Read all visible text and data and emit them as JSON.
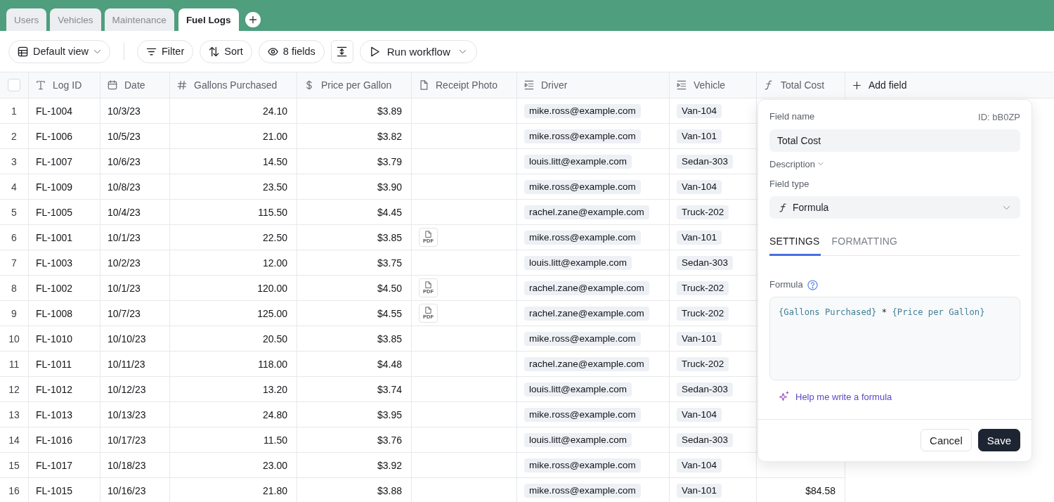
{
  "tabs": [
    {
      "label": "Users",
      "selected": false
    },
    {
      "label": "Vehicles",
      "selected": false
    },
    {
      "label": "Maintenance",
      "selected": false
    },
    {
      "label": "Fuel Logs",
      "selected": true
    }
  ],
  "toolbar": [
    {
      "kind": "view",
      "label": "Default view"
    },
    {
      "kind": "filter",
      "label": "Filter"
    },
    {
      "kind": "sort",
      "label": "Sort"
    },
    {
      "kind": "fields",
      "label": "8 fields"
    },
    {
      "kind": "row_height"
    },
    {
      "kind": "workflow",
      "label": "Run workflow"
    }
  ],
  "table": {
    "select_all": {
      "checked": false
    },
    "columns": [
      {
        "label": "Log ID",
        "kind": "text"
      },
      {
        "label": "Date",
        "kind": "date"
      },
      {
        "label": "Gallons Purchased",
        "kind": "number"
      },
      {
        "label": "Price per Gallon",
        "kind": "currency"
      },
      {
        "label": "Receipt Photo",
        "kind": "attachment"
      },
      {
        "label": "Driver",
        "kind": "link"
      },
      {
        "label": "Vehicle",
        "kind": "link"
      },
      {
        "label": "Total Cost",
        "kind": "formula"
      }
    ],
    "add_field": "Add field",
    "rows": [
      {
        "number": "1",
        "cells": [
          "FL-1004",
          "10/3/23",
          "24.10",
          "$3.89",
          null,
          "mike.ross@example.com",
          "Van-104",
          null
        ]
      },
      {
        "number": "2",
        "cells": [
          "FL-1006",
          "10/5/23",
          "21.00",
          "$3.82",
          null,
          "mike.ross@example.com",
          "Van-101",
          null
        ]
      },
      {
        "number": "3",
        "cells": [
          "FL-1007",
          "10/6/23",
          "14.50",
          "$3.79",
          null,
          "louis.litt@example.com",
          "Sedan-303",
          null
        ]
      },
      {
        "number": "4",
        "cells": [
          "FL-1009",
          "10/8/23",
          "23.50",
          "$3.90",
          null,
          "mike.ross@example.com",
          "Van-104",
          null
        ]
      },
      {
        "number": "5",
        "cells": [
          "FL-1005",
          "10/4/23",
          "115.50",
          "$4.45",
          null,
          "rachel.zane@example.com",
          "Truck-202",
          null
        ]
      },
      {
        "number": "6",
        "cells": [
          "FL-1001",
          "10/1/23",
          "22.50",
          "$3.85",
          "PDF",
          "mike.ross@example.com",
          "Van-101",
          null
        ]
      },
      {
        "number": "7",
        "cells": [
          "FL-1003",
          "10/2/23",
          "12.00",
          "$3.75",
          null,
          "louis.litt@example.com",
          "Sedan-303",
          null
        ]
      },
      {
        "number": "8",
        "cells": [
          "FL-1002",
          "10/1/23",
          "120.00",
          "$4.50",
          "PDF",
          "rachel.zane@example.com",
          "Truck-202",
          null
        ]
      },
      {
        "number": "9",
        "cells": [
          "FL-1008",
          "10/7/23",
          "125.00",
          "$4.55",
          "PDF",
          "rachel.zane@example.com",
          "Truck-202",
          null
        ]
      },
      {
        "number": "10",
        "cells": [
          "FL-1010",
          "10/10/23",
          "20.50",
          "$3.85",
          null,
          "mike.ross@example.com",
          "Van-101",
          null
        ]
      },
      {
        "number": "11",
        "cells": [
          "FL-1011",
          "10/11/23",
          "118.00",
          "$4.48",
          null,
          "rachel.zane@example.com",
          "Truck-202",
          null
        ]
      },
      {
        "number": "12",
        "cells": [
          "FL-1012",
          "10/12/23",
          "13.20",
          "$3.74",
          null,
          "louis.litt@example.com",
          "Sedan-303",
          null
        ]
      },
      {
        "number": "13",
        "cells": [
          "FL-1013",
          "10/13/23",
          "24.80",
          "$3.95",
          null,
          "mike.ross@example.com",
          "Van-104",
          null
        ]
      },
      {
        "number": "14",
        "cells": [
          "FL-1016",
          "10/17/23",
          "11.50",
          "$3.76",
          null,
          "louis.litt@example.com",
          "Sedan-303",
          null
        ]
      },
      {
        "number": "15",
        "cells": [
          "FL-1017",
          "10/18/23",
          "23.00",
          "$3.92",
          null,
          "mike.ross@example.com",
          "Van-104",
          null
        ]
      },
      {
        "number": "16",
        "cells": [
          "FL-1015",
          "10/16/23",
          "21.80",
          "$3.88",
          null,
          "mike.ross@example.com",
          "Van-101",
          "$84.58"
        ]
      }
    ]
  },
  "field_editor": {
    "name_label": "Field name",
    "field_id": "ID: bB0ZP",
    "name_value": "Total Cost",
    "description": {
      "label": "Description",
      "expanded": false
    },
    "type_label": "Field type",
    "type_value": "Formula",
    "tabs": [
      {
        "label": "SETTINGS",
        "selected": true
      },
      {
        "label": "FORMATTING",
        "selected": false
      }
    ],
    "formula_label": "Formula",
    "formula": [
      {
        "kind": "field",
        "text": "{Gallons Purchased}"
      },
      {
        "kind": "operator",
        "text": "*"
      },
      {
        "kind": "field",
        "text": "{Price per Gallon}"
      }
    ],
    "assist_link": "Help me write a formula",
    "buttons": [
      {
        "kind": "secondary",
        "label": "Cancel"
      },
      {
        "kind": "primary",
        "label": "Save"
      }
    ]
  }
}
